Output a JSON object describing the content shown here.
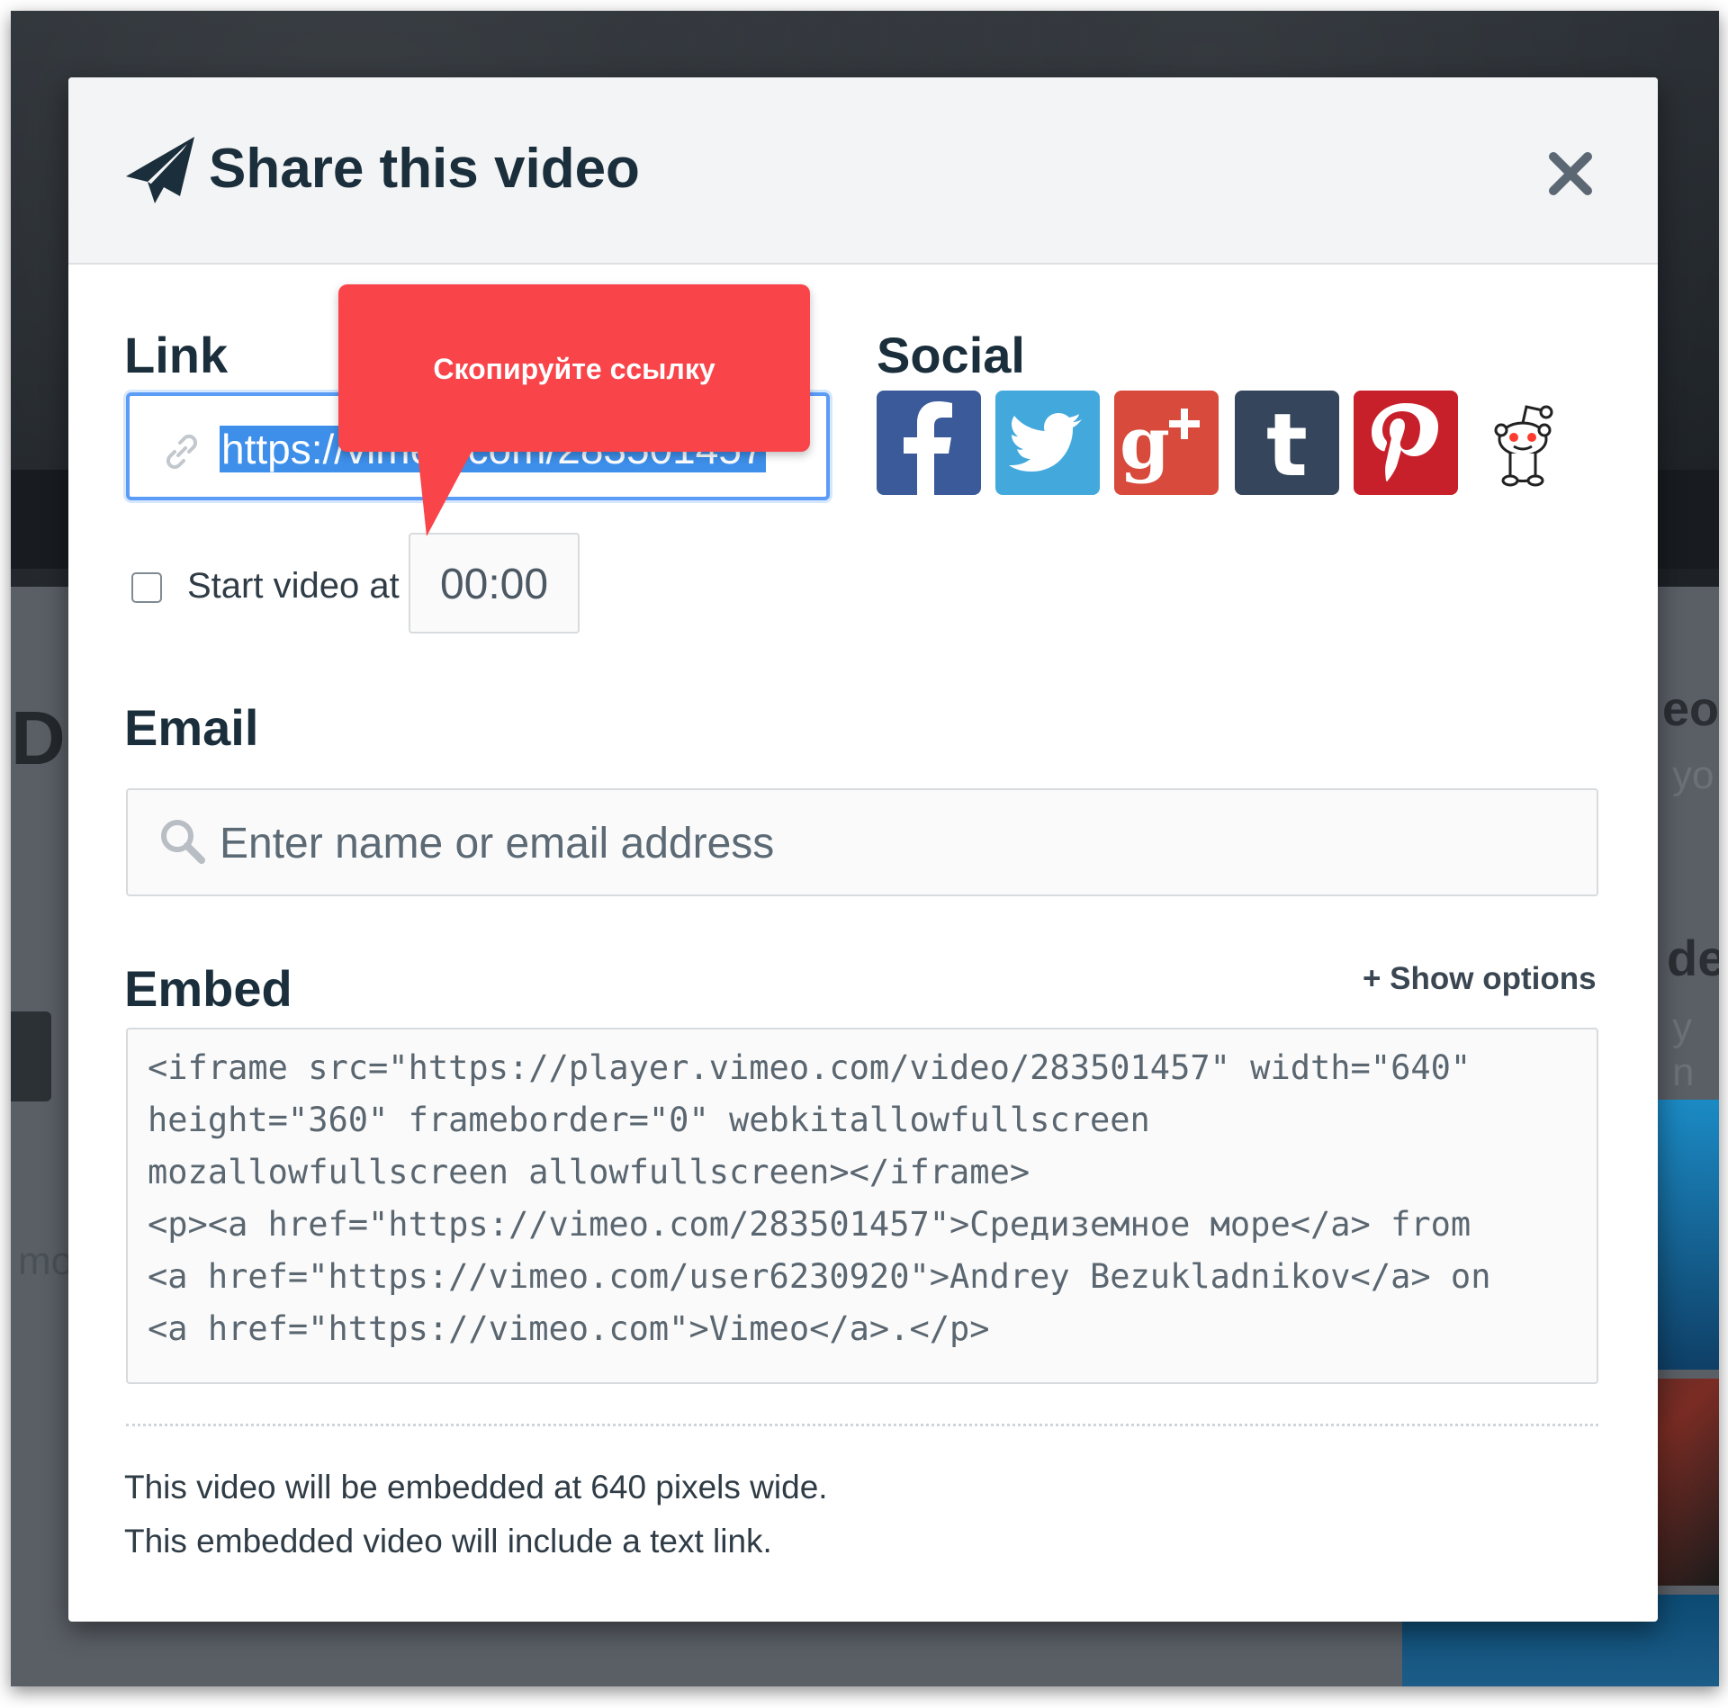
{
  "background": {
    "left_partial_heading": "De",
    "left_partial_text": "mo",
    "right_partial_heading_1": "eo",
    "right_partial_text_1": "yo",
    "right_partial_heading_2": "dec",
    "right_partial_text_2": "y n"
  },
  "modal": {
    "title": "Share this video",
    "title_icon": "paper-plane-icon",
    "close_icon": "close-icon"
  },
  "link": {
    "label": "Link",
    "url": "https://vimeo.com/283501457",
    "icon": "link-icon"
  },
  "social": {
    "label": "Social",
    "buttons": [
      "facebook-icon",
      "twitter-icon",
      "google-plus-icon",
      "tumblr-icon",
      "pinterest-icon",
      "reddit-icon"
    ]
  },
  "start_video": {
    "label": "Start video at",
    "checked": false,
    "time": "00:00"
  },
  "email": {
    "label": "Email",
    "placeholder": "Enter name or email address",
    "icon": "search-icon"
  },
  "embed": {
    "label": "Embed",
    "show_options": "+ Show options",
    "code_lines": [
      "<iframe src=\"https://player.vimeo.com/video/283501457\" width=\"640\"",
      "height=\"360\" frameborder=\"0\" webkitallowfullscreen",
      "mozallowfullscreen allowfullscreen></iframe>",
      "<p><a href=\"https://vimeo.com/283501457\">Средиземное море</a> from",
      "<a href=\"https://vimeo.com/user6230920\">Andrey Bezukladnikov</a> on",
      "<a href=\"https://vimeo.com\">Vimeo</a>.</p>"
    ]
  },
  "info": {
    "line1": "This video will be embedded at 640 pixels wide.",
    "line2": "This embedded video will include a text link."
  },
  "callout": {
    "text": "Скопируйте ссылку",
    "color": "#f9444a"
  },
  "colors": {
    "accent_blue": "#5b9cf7",
    "selection": "#3d8fea",
    "heading": "#1a2e3b"
  }
}
